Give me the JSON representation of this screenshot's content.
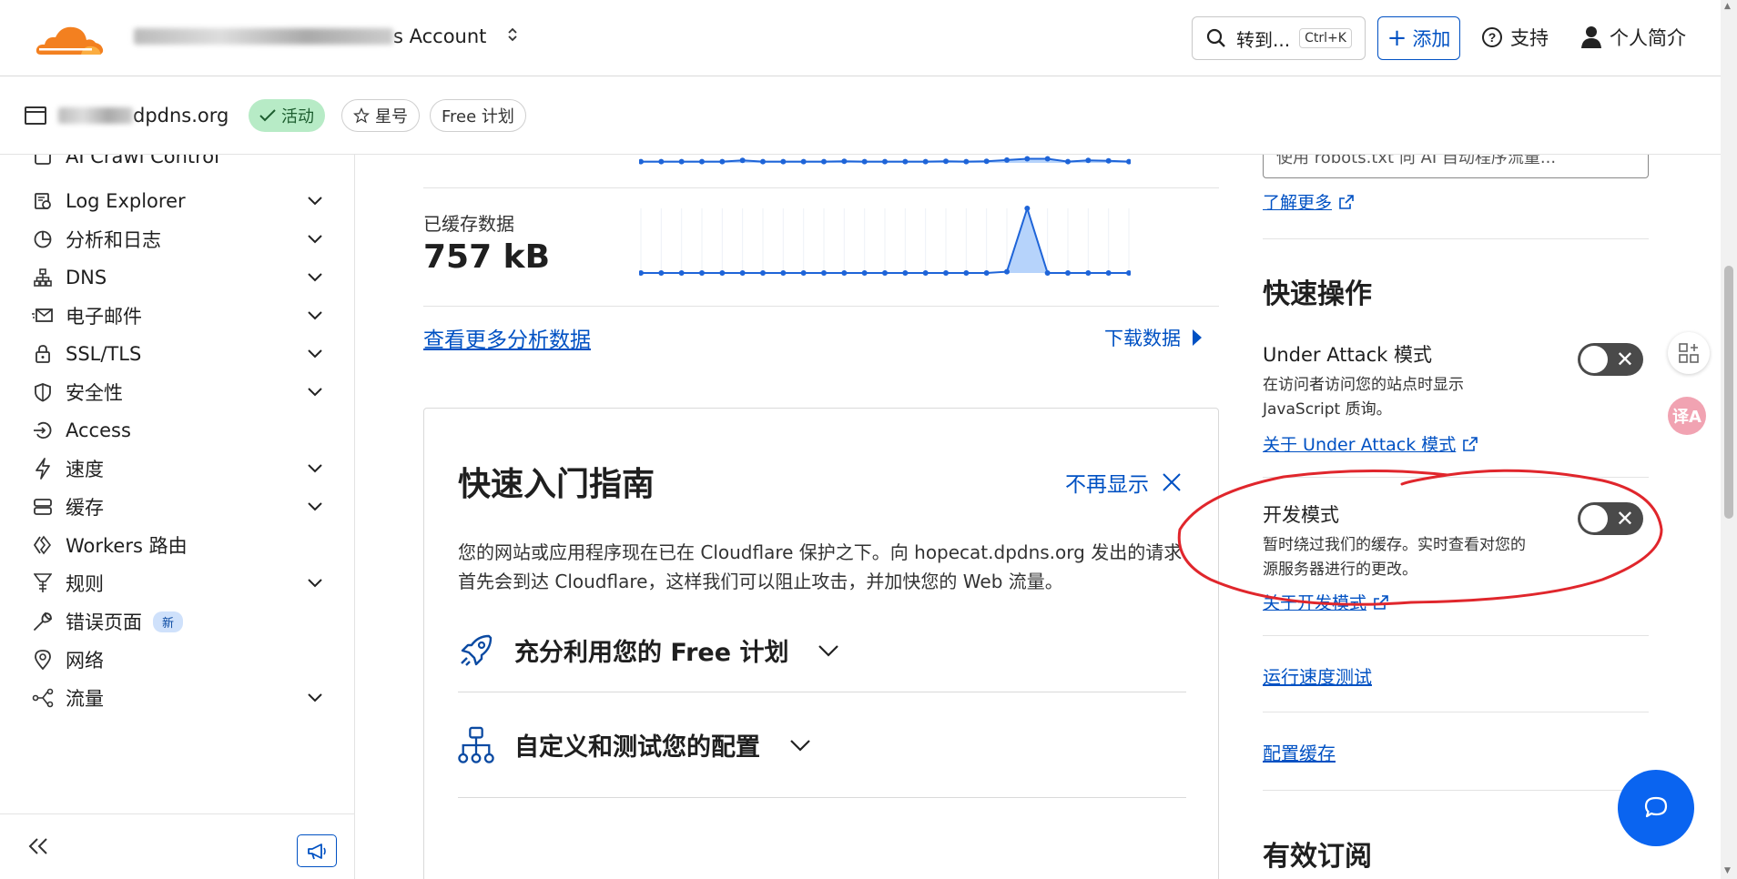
{
  "topbar": {
    "account_suffix": "s Account",
    "search_label": "转到...",
    "search_shortcut": "Ctrl+K",
    "add_label": "添加",
    "support_label": "支持",
    "profile_label": "个人简介",
    "brand_color": "#f38020",
    "accent_color": "#0051c3"
  },
  "zonebar": {
    "domain_suffix": "dpdns.org",
    "status_label": "活动",
    "star_label": "星号",
    "plan_label": "Free 计划"
  },
  "sidebar": {
    "items": [
      {
        "label": "AI Crawl Control",
        "icon": "robot-icon",
        "expandable": false
      },
      {
        "label": "Log Explorer",
        "icon": "log-explorer-icon",
        "expandable": true
      },
      {
        "label": "分析和日志",
        "icon": "analytics-icon",
        "expandable": true
      },
      {
        "label": "DNS",
        "icon": "dns-icon",
        "expandable": true
      },
      {
        "label": "电子邮件",
        "icon": "email-icon",
        "expandable": true
      },
      {
        "label": "SSL/TLS",
        "icon": "lock-icon",
        "expandable": true
      },
      {
        "label": "安全性",
        "icon": "shield-icon",
        "expandable": true
      },
      {
        "label": "Access",
        "icon": "access-icon",
        "expandable": false
      },
      {
        "label": "速度",
        "icon": "bolt-icon",
        "expandable": true
      },
      {
        "label": "缓存",
        "icon": "cache-icon",
        "expandable": true
      },
      {
        "label": "Workers 路由",
        "icon": "workers-icon",
        "expandable": false
      },
      {
        "label": "规则",
        "icon": "rules-icon",
        "expandable": true
      },
      {
        "label": "错误页面",
        "icon": "wrench-icon",
        "expandable": false,
        "badge": "新"
      },
      {
        "label": "网络",
        "icon": "location-pin-icon",
        "expandable": false
      },
      {
        "label": "流量",
        "icon": "traffic-icon",
        "expandable": true
      }
    ]
  },
  "main": {
    "cached_label": "已缓存数据",
    "cached_value": "757 kB",
    "more_analytics_link": "查看更多分析数据",
    "download_link": "下载数据",
    "guide": {
      "title": "快速入门指南",
      "dismiss_label": "不再显示",
      "description": "您的网站或应用程序现在已在 Cloudflare 保护之下。向 hopecat.dpdns.org 发出的请求首先会到达 Cloudflare，这样我们可以阻止攻击，并加快您的 Web 流量。",
      "accordion": [
        {
          "label": "充分利用您的 Free 计划",
          "icon": "rocket-icon"
        },
        {
          "label": "自定义和测试您的配置",
          "icon": "hierarchy-icon"
        }
      ]
    }
  },
  "right": {
    "robots_input_value": "使用 robots.txt 向 AI 自动程序流量...",
    "learn_more": "了解更多",
    "quick_actions_title": "快速操作",
    "under_attack": {
      "title": "Under Attack 模式",
      "description": "在访问者访问您的站点时显示 JavaScript 质询。",
      "link": "关于 Under Attack 模式",
      "enabled": false
    },
    "dev_mode": {
      "title": "开发模式",
      "description": "暂时绕过我们的缓存。实时查看对您的源服务器进行的更改。",
      "link": "关于开发模式",
      "enabled": false
    },
    "speed_test_link": "运行速度测试",
    "configure_cache_link": "配置缓存",
    "subscriptions_title": "有效订阅"
  },
  "floating": {
    "translate_label": "译A"
  },
  "chart_data": [
    {
      "type": "line",
      "title": "",
      "x": [
        1,
        2,
        3,
        4,
        5,
        6,
        7,
        8,
        9,
        10,
        11,
        12,
        13,
        14,
        15,
        16,
        17,
        18,
        19,
        20,
        21,
        22,
        23,
        24,
        25
      ],
      "values": [
        0.15,
        0.15,
        0.15,
        0.15,
        0.15,
        0.3,
        0.15,
        0.15,
        0.15,
        0.15,
        0.2,
        0.15,
        0.15,
        0.15,
        0.15,
        0.2,
        0.15,
        0.2,
        0.35,
        0.5,
        0.5,
        0.15,
        0.3,
        0.25,
        0.15
      ],
      "ylim": [
        0,
        1
      ]
    },
    {
      "type": "area",
      "title": "已缓存数据",
      "x": [
        1,
        2,
        3,
        4,
        5,
        6,
        7,
        8,
        9,
        10,
        11,
        12,
        13,
        14,
        15,
        16,
        17,
        18,
        19,
        20,
        21,
        22,
        23,
        24,
        25
      ],
      "values": [
        0,
        0,
        0,
        0,
        0,
        0,
        0,
        0,
        0,
        0,
        0,
        0,
        0,
        0,
        0,
        0,
        0,
        0,
        0.02,
        1,
        0,
        0,
        0,
        0,
        0
      ],
      "ylim": [
        0,
        1
      ]
    }
  ]
}
